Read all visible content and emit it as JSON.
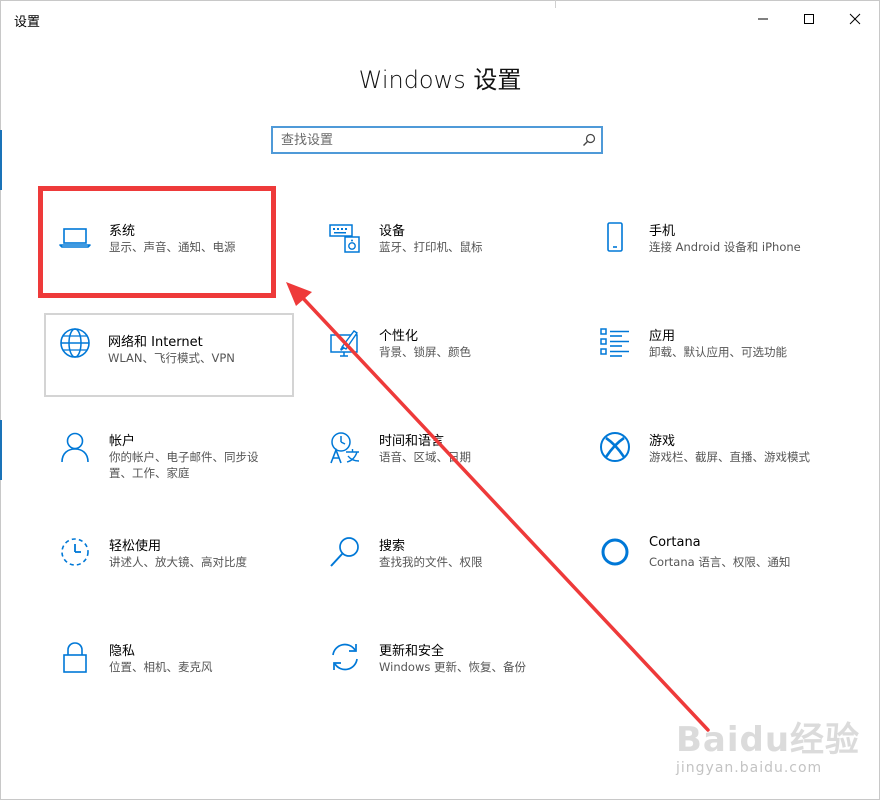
{
  "window": {
    "title": "设置"
  },
  "page": {
    "heading": "Windows 设置"
  },
  "search": {
    "placeholder": "查找设置"
  },
  "tiles": [
    {
      "id": "system",
      "title": "系统",
      "desc": "显示、声音、通知、电源",
      "icon": "laptop-icon"
    },
    {
      "id": "devices",
      "title": "设备",
      "desc": "蓝牙、打印机、鼠标",
      "icon": "keyboard-speaker-icon"
    },
    {
      "id": "phone",
      "title": "手机",
      "desc": "连接 Android 设备和 iPhone",
      "icon": "phone-icon"
    },
    {
      "id": "network",
      "title": "网络和 Internet",
      "desc": "WLAN、飞行模式、VPN",
      "icon": "globe-icon"
    },
    {
      "id": "personalization",
      "title": "个性化",
      "desc": "背景、锁屏、颜色",
      "icon": "paint-icon"
    },
    {
      "id": "apps",
      "title": "应用",
      "desc": "卸载、默认应用、可选功能",
      "icon": "apps-list-icon"
    },
    {
      "id": "accounts",
      "title": "帐户",
      "desc": "你的帐户、电子邮件、同步设置、工作、家庭",
      "icon": "person-icon"
    },
    {
      "id": "time-language",
      "title": "时间和语言",
      "desc": "语音、区域、日期",
      "icon": "time-language-icon"
    },
    {
      "id": "gaming",
      "title": "游戏",
      "desc": "游戏栏、截屏、直播、游戏模式",
      "icon": "xbox-icon"
    },
    {
      "id": "ease-of-access",
      "title": "轻松使用",
      "desc": "讲述人、放大镜、高对比度",
      "icon": "ease-of-access-icon"
    },
    {
      "id": "search",
      "title": "搜索",
      "desc": "查找我的文件、权限",
      "icon": "magnifier-icon"
    },
    {
      "id": "cortana",
      "title": "Cortana",
      "desc": "Cortana 语言、权限、通知",
      "icon": "cortana-ring-icon"
    },
    {
      "id": "privacy",
      "title": "隐私",
      "desc": "位置、相机、麦克风",
      "icon": "lock-icon"
    },
    {
      "id": "update-security",
      "title": "更新和安全",
      "desc": "Windows 更新、恢复、备份",
      "icon": "sync-icon"
    }
  ],
  "watermark": {
    "brand": "Baidu经验",
    "url": "jingyan.baidu.com"
  },
  "colors": {
    "accent": "#0078d7",
    "highlight": "#ee3a3a"
  }
}
